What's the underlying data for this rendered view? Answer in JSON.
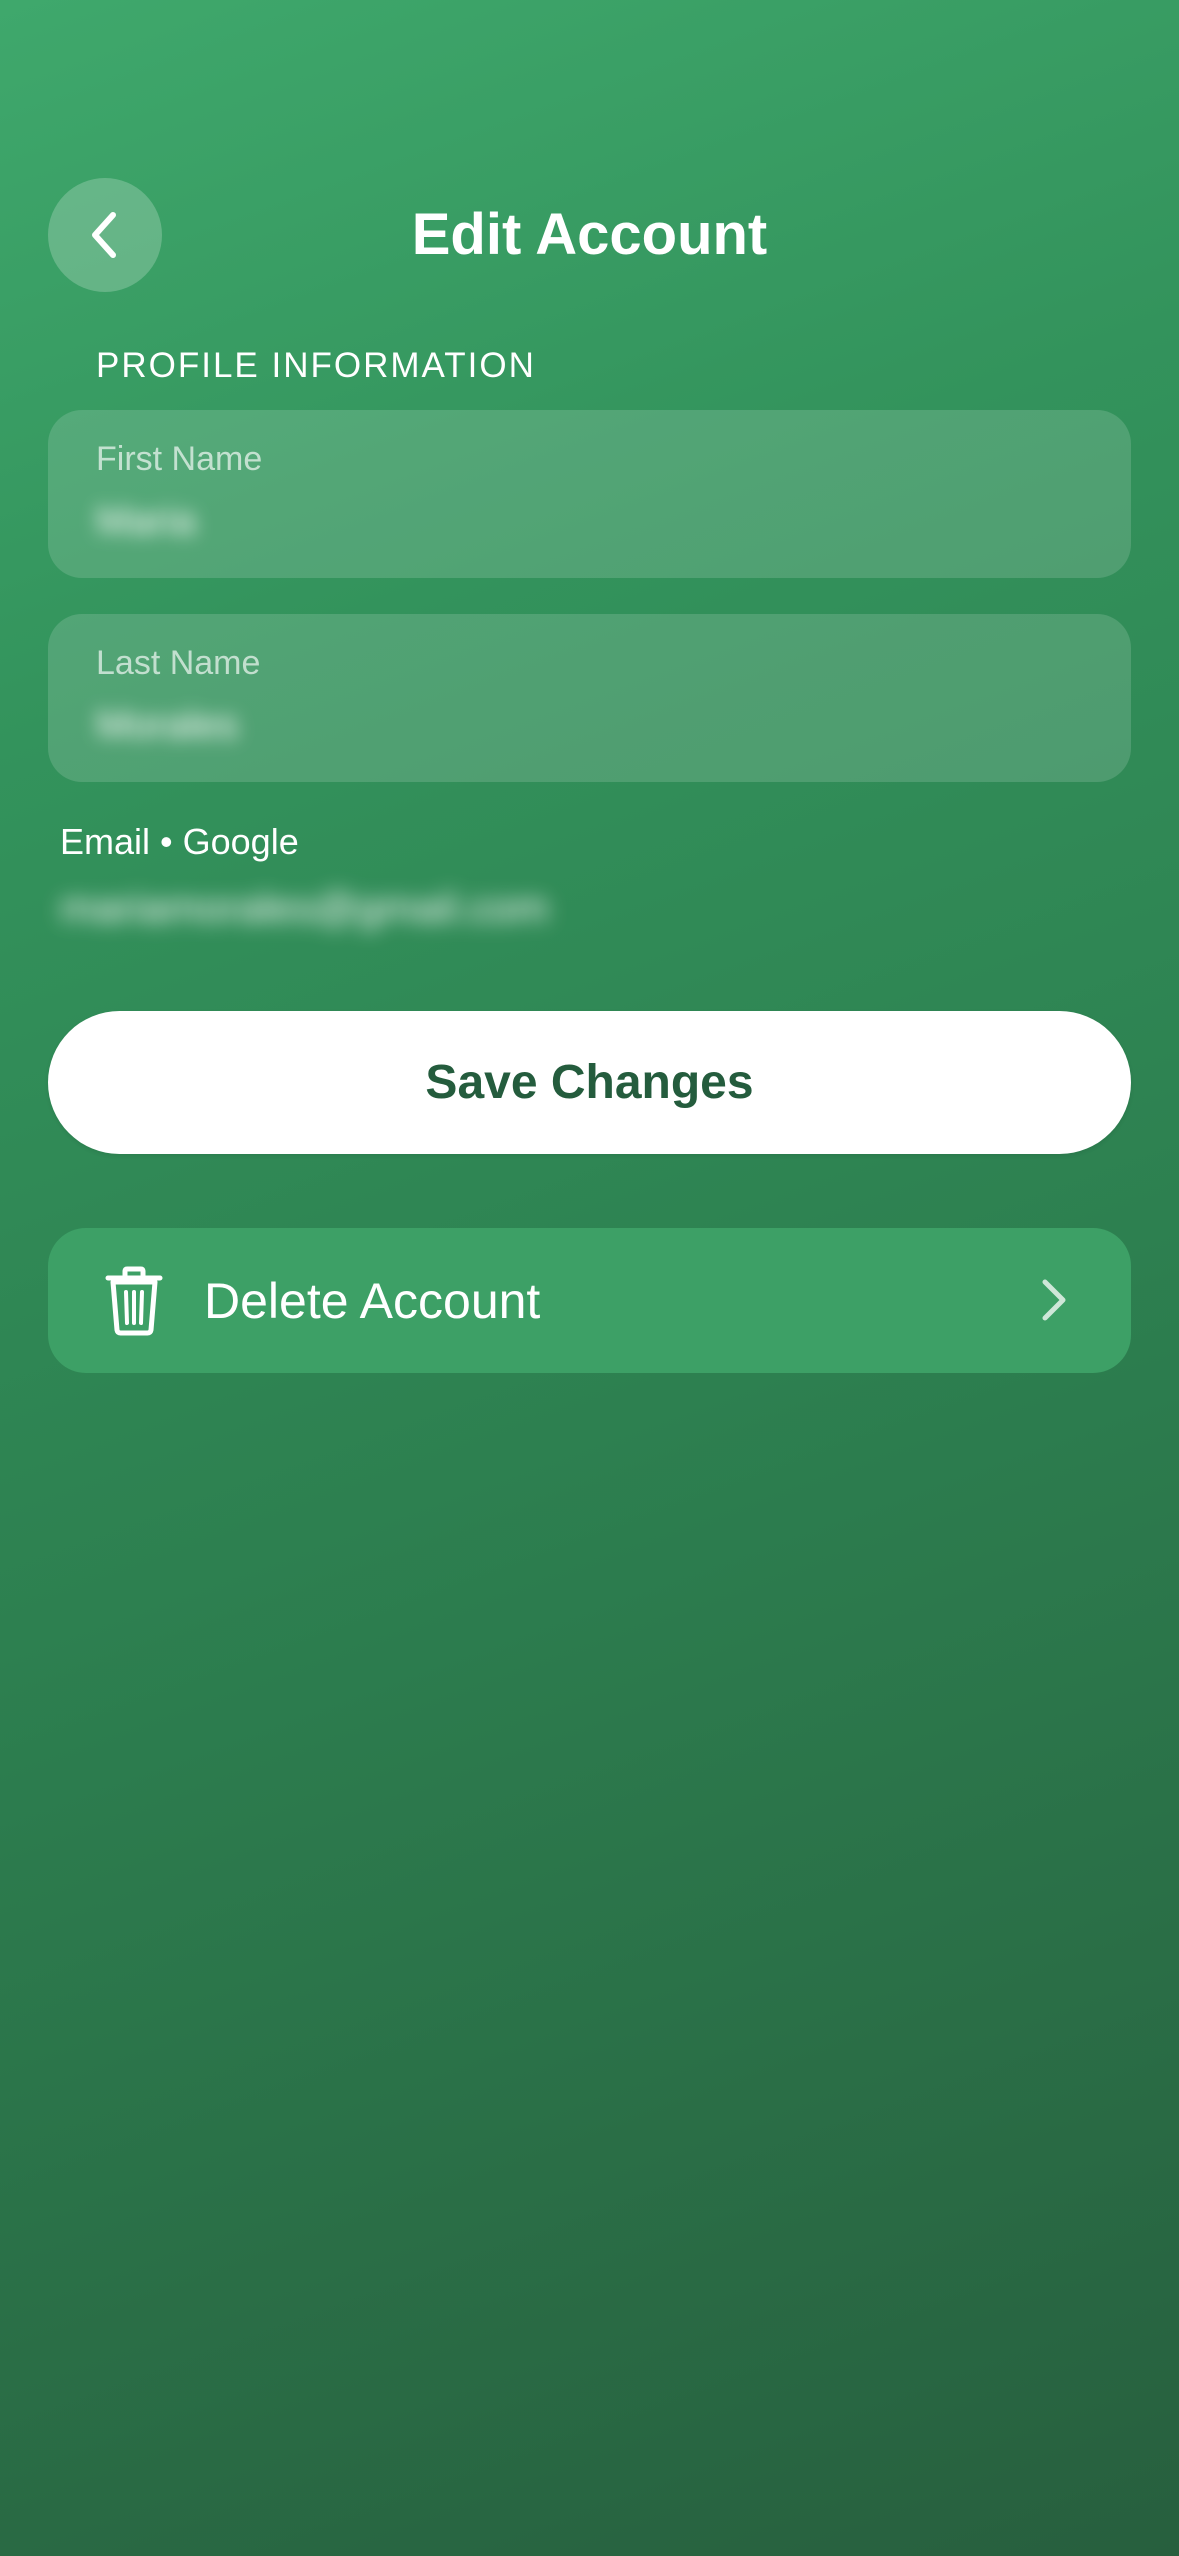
{
  "header": {
    "title": "Edit Account",
    "back_icon": "chevron-left-icon"
  },
  "profile": {
    "section_heading": "PROFILE INFORMATION",
    "first_name": {
      "label": "First Name",
      "value": "Maria"
    },
    "last_name": {
      "label": "Last Name",
      "value": "Morales"
    }
  },
  "email": {
    "label": "Email • Google",
    "value": "mariamorales@gmail.com"
  },
  "actions": {
    "save_label": "Save Changes",
    "delete_label": "Delete Account",
    "delete_icon": "trash-icon",
    "delete_chevron_icon": "chevron-right-icon"
  },
  "colors": {
    "background_top": "#3fa86c",
    "background_bottom": "#275f3e",
    "save_text": "#245c3d",
    "delete_row": "#3da066"
  }
}
